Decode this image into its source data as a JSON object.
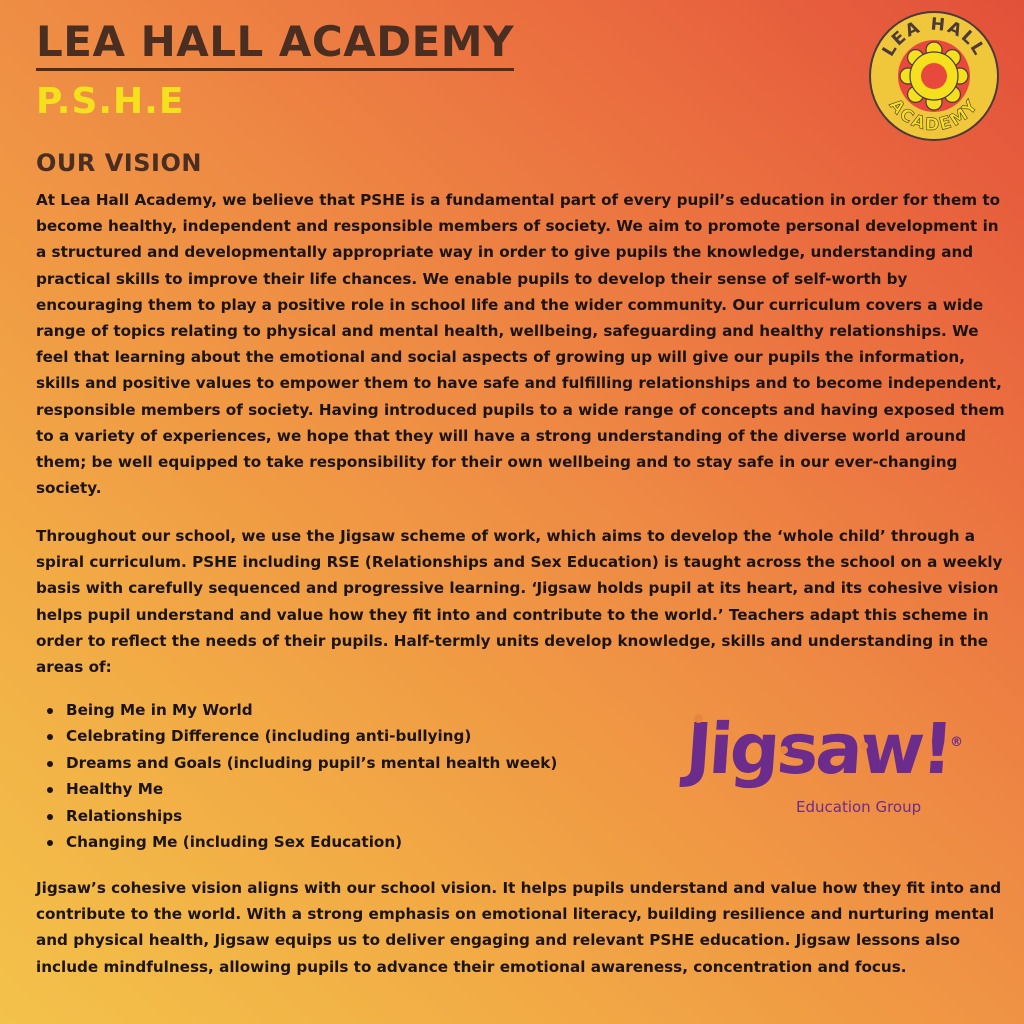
{
  "header": {
    "school_name": "LEA HALL ACADEMY",
    "subject": "P.S.H.E"
  },
  "school_logo": {
    "icon": "sunburst-puzzle-logo",
    "ring_text_top": "LEA HALL",
    "ring_text_bottom": "ACADEMY",
    "colors": {
      "ring": "#f0c63a",
      "ring_outline": "#4a3a3a",
      "sun": "#f5e01d",
      "center": "#e8493c"
    }
  },
  "vision": {
    "heading": "OUR VISION",
    "paragraph_1": "At Lea Hall Academy, we believe that PSHE is a fundamental part of every pupil’s education in order for them to become healthy, independent and responsible members of society. We aim to promote personal development in a structured and developmentally appropriate way in order to give pupils the knowledge, understanding and practical skills to improve their life chances. We enable pupils to develop their sense of self-worth by encouraging them to play a positive role in school life and the wider community. Our curriculum covers a wide range of topics relating to physical and mental health, wellbeing, safeguarding and healthy relationships. We feel that learning about the emotional and social aspects of growing up will give our pupils the information, skills and positive values to empower them to have safe and fulfilling relationships and to become independent, responsible members of society. Having introduced pupils to a wide range of concepts and having exposed them to a variety of experiences, we hope that they will have a strong understanding of the diverse world around them; be well equipped to take responsibility for their own wellbeing and to stay safe in our ever-changing society.",
    "paragraph_2": "Throughout our school, we use the Jigsaw scheme of work, which aims to develop the ‘whole child’ through a spiral curriculum. PSHE including RSE (Relationships and Sex Education) is taught across the school on a weekly basis with carefully sequenced and progressive learning.  ‘Jigsaw holds pupil at its heart, and its cohesive vision helps pupil understand and value how they fit into and contribute to the world.’ Teachers adapt this scheme in order to reflect the needs of their pupils. Half-termly units develop knowledge, skills and understanding in the areas of:",
    "topics": [
      "Being Me in My World",
      "Celebrating Difference (including anti-bullying)",
      "Dreams and Goals (including pupil’s mental health week)",
      "Healthy Me",
      "Relationships",
      "Changing Me (including Sex Education)"
    ],
    "paragraph_3": "Jigsaw’s cohesive vision aligns with our school vision. It helps pupils understand and value how they fit into and contribute to the world. With a strong emphasis on emotional literacy, building resilience and nurturing mental and physical health, Jigsaw equips us to deliver engaging and relevant PSHE education. Jigsaw lessons also include mindfulness, allowing pupils to advance their emotional awareness, concentration and focus."
  },
  "partner_logo": {
    "wordmark": "Jigsaw!",
    "registered": "®",
    "caption": "Education Group",
    "color": "#6b2c8c"
  }
}
